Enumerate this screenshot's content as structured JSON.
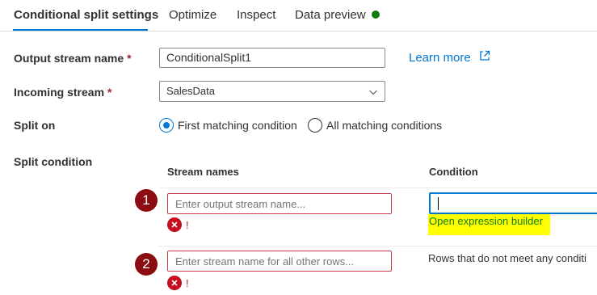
{
  "tabs": [
    {
      "label": "Conditional split settings",
      "active": true
    },
    {
      "label": "Optimize",
      "active": false
    },
    {
      "label": "Inspect",
      "active": false
    },
    {
      "label": "Data preview",
      "active": false,
      "status_color": "#107c10"
    }
  ],
  "form": {
    "output_stream": {
      "label": "Output stream name",
      "required_mark": "*",
      "value": "ConditionalSplit1"
    },
    "learn_more": "Learn more",
    "incoming_stream": {
      "label": "Incoming stream",
      "required_mark": "*",
      "value": "SalesData"
    },
    "split_on": {
      "label": "Split on",
      "options": [
        {
          "label": "First matching condition",
          "selected": true
        },
        {
          "label": "All matching conditions",
          "selected": false
        }
      ]
    },
    "split_condition": {
      "label": "Split condition",
      "columns": [
        "Stream names",
        "Condition"
      ],
      "rows": [
        {
          "number": "1",
          "stream_placeholder": "Enter output stream name...",
          "error_text": "!",
          "condition_value": "",
          "expression_builder": "Open expression builder"
        },
        {
          "number": "2",
          "stream_placeholder": "Enter stream name for all other rows...",
          "error_text": "!",
          "condition_text": "Rows that do not meet any conditi"
        }
      ]
    }
  },
  "colors": {
    "accent": "#0078d4",
    "error": "#c50f1f",
    "badge": "#8b0d12",
    "highlight": "#ffff00",
    "success": "#107c10"
  },
  "icons": {
    "external_link": "external-link-icon",
    "dropdown": "chevron-down-icon",
    "error": "error-circle-icon",
    "status": "status-dot-icon"
  }
}
